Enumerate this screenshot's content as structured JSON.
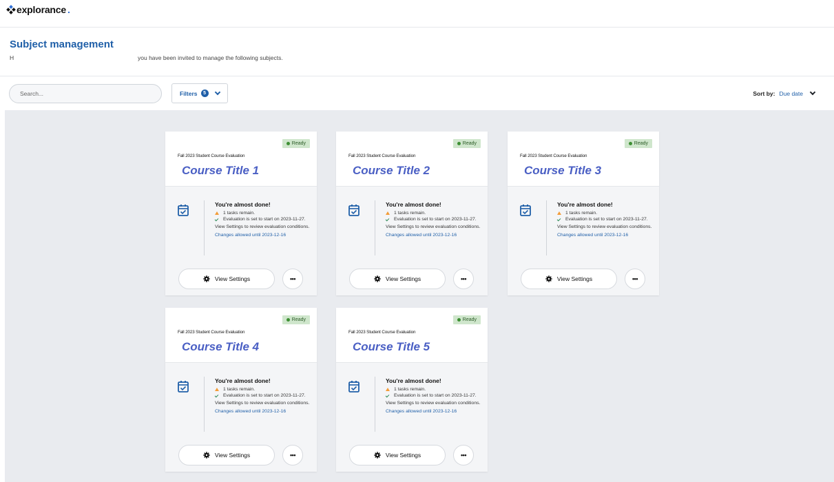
{
  "brand": {
    "name": "explorance",
    "suffix": "."
  },
  "header": {
    "title": "Subject management",
    "greeting": "H",
    "intro": "you have been invited to manage the following subjects."
  },
  "toolbar": {
    "search_placeholder": "Search...",
    "filters_label": "Filters",
    "filters_count": "5",
    "sort_label": "Sort by:",
    "sort_value": "Due date"
  },
  "card_labels": {
    "status": "Ready",
    "heading": "You're almost done!",
    "view_settings": "View Settings",
    "more": "•••"
  },
  "cards": [
    {
      "evaluation": "Fall 2023 Student Course Evaluation",
      "title": "Course Title 1",
      "tasks": "1 tasks remain.",
      "start": "Evaluation is set to start on 2023-11-27.",
      "info": "View Settings to review evaluation conditions.",
      "changes": "Changes allowed until 2023-12-16"
    },
    {
      "evaluation": "Fall 2023 Student Course Evaluation",
      "title": "Course Title 2",
      "tasks": "1 tasks remain.",
      "start": "Evaluation is set to start on 2023-11-27.",
      "info": "View Settings to review evaluation conditions.",
      "changes": "Changes allowed until 2023-12-16"
    },
    {
      "evaluation": "Fall 2023 Student Course Evaluation",
      "title": "Course Title 3",
      "tasks": "1 tasks remain.",
      "start": "Evaluation is set to start on 2023-11-27.",
      "info": "View Settings to review evaluation conditions.",
      "changes": "Changes allowed until 2023-12-16"
    },
    {
      "evaluation": "Fall 2023 Student Course Evaluation",
      "title": "Course Title 4",
      "tasks": "1 tasks remain.",
      "start": "Evaluation is set to start on 2023-11-27.",
      "info": "View Settings to review evaluation conditions.",
      "changes": "Changes allowed until 2023-12-16"
    },
    {
      "evaluation": "Fall 2023 Student Course Evaluation",
      "title": "Course Title 5",
      "tasks": "1 tasks remain.",
      "start": "Evaluation is set to start on 2023-11-27.",
      "info": "View Settings to review evaluation conditions.",
      "changes": "Changes allowed until 2023-12-16"
    }
  ],
  "colors": {
    "accent": "#1f5fa8",
    "course_title": "#4a5fc4",
    "ready_bg": "#cfe6cc",
    "canvas_bg": "#e9ebef"
  }
}
